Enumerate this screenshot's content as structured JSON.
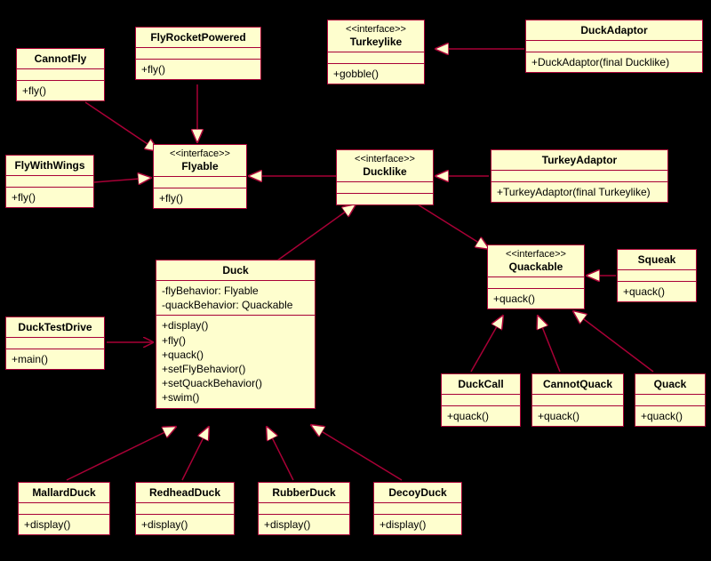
{
  "classes": {
    "CannotFly": {
      "name": "CannotFly",
      "stereotype": "",
      "attrs": [],
      "ops": [
        "+fly()"
      ]
    },
    "FlyRocketPowered": {
      "name": "FlyRocketPowered",
      "stereotype": "",
      "attrs": [],
      "ops": [
        "+fly()"
      ]
    },
    "Turkeylike": {
      "name": "Turkeylike",
      "stereotype": "<<interface>>",
      "attrs": [],
      "ops": [
        "+gobble()"
      ]
    },
    "DuckAdaptor": {
      "name": "DuckAdaptor",
      "stereotype": "",
      "attrs": [],
      "ops": [
        "+DuckAdaptor(final Ducklike)"
      ]
    },
    "FlyWithWings": {
      "name": "FlyWithWings",
      "stereotype": "",
      "attrs": [],
      "ops": [
        "+fly()"
      ]
    },
    "Flyable": {
      "name": "Flyable",
      "stereotype": "<<interface>>",
      "attrs": [],
      "ops": [
        "+fly()"
      ]
    },
    "Ducklike": {
      "name": "Ducklike",
      "stereotype": "<<interface>>",
      "attrs": [],
      "ops": []
    },
    "TurkeyAdaptor": {
      "name": "TurkeyAdaptor",
      "stereotype": "",
      "attrs": [],
      "ops": [
        "+TurkeyAdaptor(final Turkeylike)"
      ]
    },
    "Quackable": {
      "name": "Quackable",
      "stereotype": "<<interface>>",
      "attrs": [],
      "ops": [
        "+quack()"
      ]
    },
    "Squeak": {
      "name": "Squeak",
      "stereotype": "",
      "attrs": [],
      "ops": [
        "+quack()"
      ]
    },
    "DuckTestDrive": {
      "name": "DuckTestDrive",
      "stereotype": "",
      "attrs": [],
      "ops": [
        "+main()"
      ]
    },
    "Duck": {
      "name": "Duck",
      "stereotype": "",
      "attrs": [
        "-flyBehavior: Flyable",
        "-quackBehavior: Quackable"
      ],
      "ops": [
        "+display()",
        "+fly()",
        "+quack()",
        "+setFlyBehavior()",
        "+setQuackBehavior()",
        "+swim()"
      ]
    },
    "DuckCall": {
      "name": "DuckCall",
      "stereotype": "",
      "attrs": [],
      "ops": [
        "+quack()"
      ]
    },
    "CannotQuack": {
      "name": "CannotQuack",
      "stereotype": "",
      "attrs": [],
      "ops": [
        "+quack()"
      ]
    },
    "Quack": {
      "name": "Quack",
      "stereotype": "",
      "attrs": [],
      "ops": [
        "+quack()"
      ]
    },
    "MallardDuck": {
      "name": "MallardDuck",
      "stereotype": "",
      "attrs": [],
      "ops": [
        "+display()"
      ]
    },
    "RedheadDuck": {
      "name": "RedheadDuck",
      "stereotype": "",
      "attrs": [],
      "ops": [
        "+display()"
      ]
    },
    "RubberDuck": {
      "name": "RubberDuck",
      "stereotype": "",
      "attrs": [],
      "ops": [
        "+display()"
      ]
    },
    "DecoyDuck": {
      "name": "DecoyDuck",
      "stereotype": "",
      "attrs": [],
      "ops": [
        "+display()"
      ]
    }
  }
}
